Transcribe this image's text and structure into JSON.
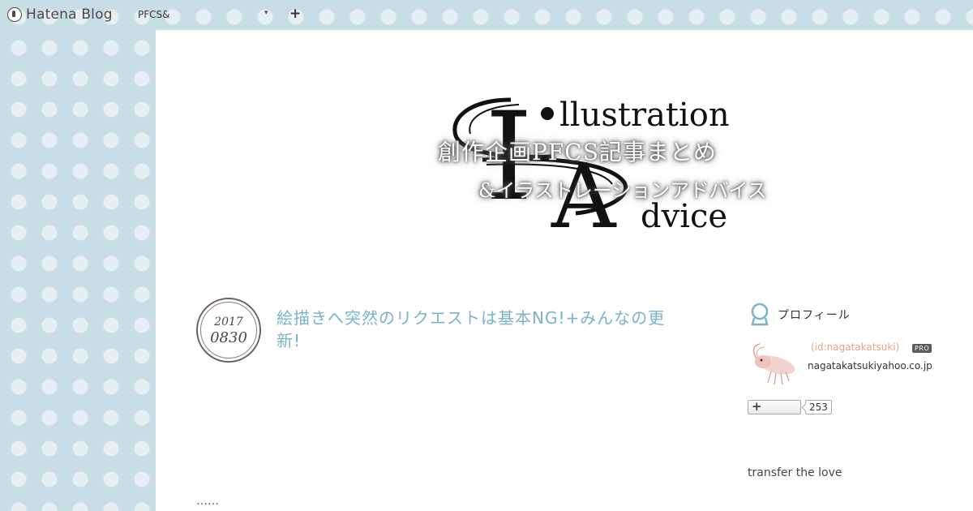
{
  "navbar": {
    "logo_text": "Hatena Blog",
    "blog_selector": "PFCS&",
    "add_label": "+"
  },
  "banner": {
    "logo_letters": {
      "big_i": "I",
      "big_a": "A",
      "word1": "llustration",
      "word2": "dvice"
    },
    "title": "創作企画PFCS記事まとめ",
    "subtitle": "&イラストレーションアドバイス"
  },
  "entry": {
    "date_year": "2017",
    "date_monthday": "0830",
    "title": "絵描きへ突然のリクエストは基本NG!+みんなの更新!",
    "excerpt": "……"
  },
  "sidebar": {
    "profile_heading": "プロフィール",
    "profile_id": "(id:nagatakatsuki)",
    "pro_badge": "PRO",
    "profile_email": "nagatakatsukiyahoo.co.jp",
    "subscribe_plus": "+",
    "subscriber_count": "253",
    "text": "transfer the love"
  },
  "colors": {
    "background": "#c9dde4",
    "dots": "#e6f0f3",
    "entry_title": "#7bb3cb",
    "profile_id": "#e8a386"
  }
}
